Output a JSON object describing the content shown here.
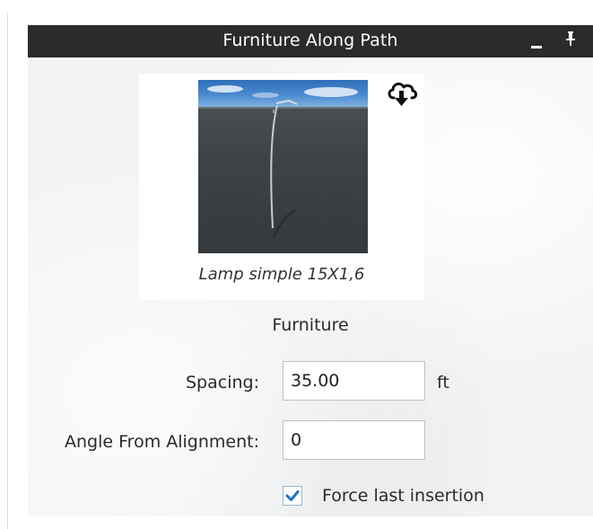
{
  "panel": {
    "title": "Furniture Along Path",
    "minimize_icon": "minimize-icon",
    "pin_icon": "pin-icon"
  },
  "preview": {
    "caption": "Lamp simple 15X1,6",
    "download_icon": "cloud-download-icon"
  },
  "section": {
    "label": "Furniture"
  },
  "spacing": {
    "label": "Spacing:",
    "value": "35.00",
    "unit": "ft"
  },
  "angle": {
    "label": "Angle From Alignment:",
    "value": "0"
  },
  "force_last": {
    "label": "Force last insertion",
    "checked": true
  },
  "colors": {
    "titlebar_bg": "#2b2b2b",
    "panel_bg": "#f2f3f4",
    "check_accent": "#1a73c9"
  }
}
